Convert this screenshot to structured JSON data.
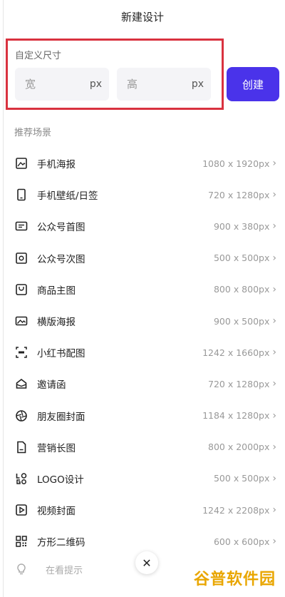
{
  "header": {
    "title": "新建设计"
  },
  "custom_size": {
    "label": "自定义尺寸",
    "width_placeholder": "宽",
    "height_placeholder": "高",
    "unit": "px",
    "create_label": "创建"
  },
  "scenes": {
    "title": "推荐场景",
    "items": [
      {
        "name": "手机海报",
        "size": "1080 x 1920px",
        "icon": "image-icon"
      },
      {
        "name": "手机壁纸/日签",
        "size": "720 x 1280px",
        "icon": "phone-icon"
      },
      {
        "name": "公众号首图",
        "size": "900 x 380px",
        "icon": "banner-icon"
      },
      {
        "name": "公众号次图",
        "size": "500 x 500px",
        "icon": "square-image-icon"
      },
      {
        "name": "商品主图",
        "size": "800 x 800px",
        "icon": "shopping-bag-icon"
      },
      {
        "name": "横版海报",
        "size": "900 x 500px",
        "icon": "landscape-image-icon"
      },
      {
        "name": "小红书配图",
        "size": "1242 x 1660px",
        "icon": "xiaohongshu-icon"
      },
      {
        "name": "邀请函",
        "size": "720 x 1280px",
        "icon": "envelope-icon"
      },
      {
        "name": "朋友圈封面",
        "size": "1184 x 1280px",
        "icon": "aperture-icon"
      },
      {
        "name": "营销长图",
        "size": "800 x 2000px",
        "icon": "document-icon"
      },
      {
        "name": "LOGO设计",
        "size": "500 x 500px",
        "icon": "logo-icon"
      },
      {
        "name": "视频封面",
        "size": "1242 x 2208px",
        "icon": "play-icon"
      },
      {
        "name": "方形二维码",
        "size": "600 x 600px",
        "icon": "qrcode-icon"
      }
    ],
    "arrow": "›"
  },
  "hint": {
    "label": "在看提示",
    "icon": "lightbulb-icon"
  },
  "close": {
    "glyph": "✕"
  },
  "watermark": {
    "text": "谷普软件园"
  },
  "colors": {
    "accent": "#4a33ea",
    "highlight_border": "#d9323f",
    "watermark": "#e9a600"
  }
}
